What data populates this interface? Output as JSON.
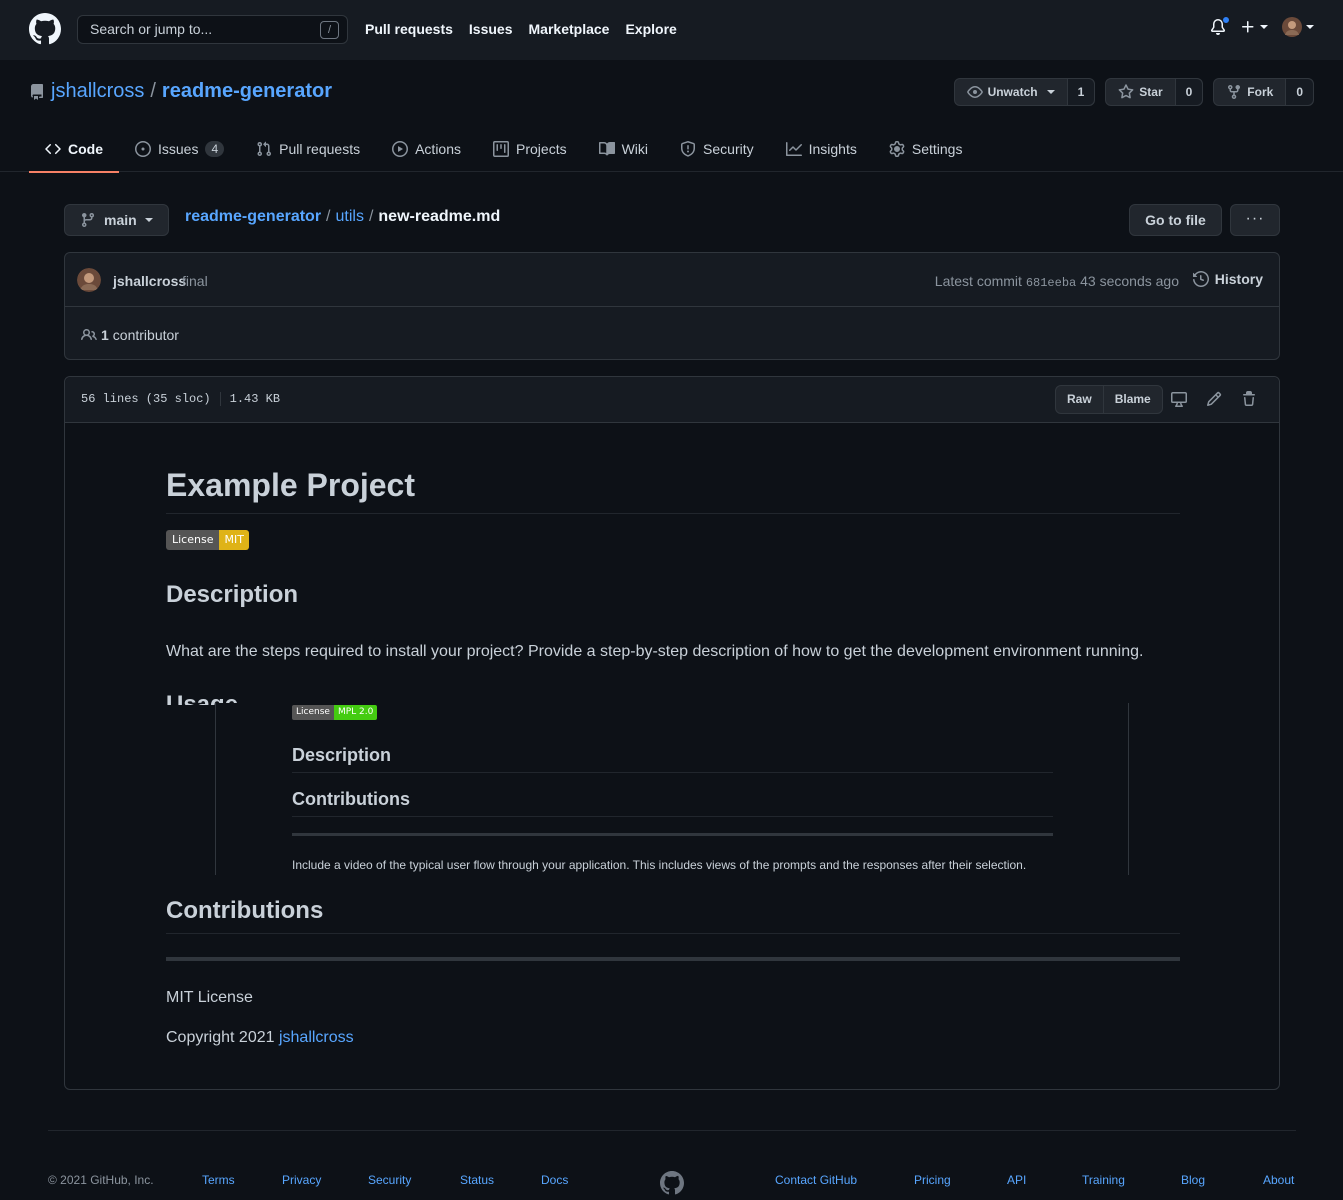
{
  "header": {
    "search_placeholder": "Search or jump to...",
    "search_shortcut": "/",
    "nav": [
      "Pull requests",
      "Issues",
      "Marketplace",
      "Explore"
    ]
  },
  "repo": {
    "owner": "jshallcross",
    "separator": "/",
    "name": "readme-generator",
    "watch_label": "Unwatch",
    "watch_count": "1",
    "star_label": "Star",
    "star_count": "0",
    "fork_label": "Fork",
    "fork_count": "0"
  },
  "tabs": [
    {
      "label": "Code",
      "active": true
    },
    {
      "label": "Issues",
      "count": "4"
    },
    {
      "label": "Pull requests"
    },
    {
      "label": "Actions"
    },
    {
      "label": "Projects"
    },
    {
      "label": "Wiki"
    },
    {
      "label": "Security"
    },
    {
      "label": "Insights"
    },
    {
      "label": "Settings"
    }
  ],
  "filenav": {
    "branch": "main",
    "crumb_root": "readme-generator",
    "crumb_dir": "utils",
    "crumb_file": "new-readme.md",
    "goto_file": "Go to file",
    "more": "···"
  },
  "commit": {
    "author": "jshallcross",
    "message": "final",
    "latest_label": "Latest commit",
    "sha": "681eeba",
    "time": "43 seconds ago",
    "history": "History",
    "contributors_count": "1",
    "contributors_label": "contributor"
  },
  "file": {
    "lines": "56 lines (35 sloc)",
    "size": "1.43 KB",
    "raw": "Raw",
    "blame": "Blame"
  },
  "markdown": {
    "title": "Example Project",
    "badge_left": "License",
    "badge_right": "MIT",
    "h_description": "Description",
    "p_description": "What are the steps required to install your project? Provide a step-by-step description of how to get the development environment running.",
    "h_usage": "Usage",
    "h_contributions": "Contributions",
    "p_license": "MIT License",
    "p_copyright": "Copyright 2021",
    "p_copyright_link": "jshallcross"
  },
  "embedded_screenshot": {
    "badge_left": "License",
    "badge_right": "MPL 2.0",
    "h_description": "Description",
    "h_contributions": "Contributions",
    "paragraph": "Include a video of the typical user flow through your application. This includes views of the prompts and the responses after their selection."
  },
  "footer": {
    "copyright": "© 2021 GitHub, Inc.",
    "left_links": [
      "Terms",
      "Privacy",
      "Security",
      "Status",
      "Docs"
    ],
    "right_links": [
      "Contact GitHub",
      "Pricing",
      "API",
      "Training",
      "Blog",
      "About"
    ]
  },
  "colors": {
    "background": "#0d1117",
    "link": "#58a6ff",
    "tab_underline": "#f78166",
    "notification": "#2f81f7"
  }
}
